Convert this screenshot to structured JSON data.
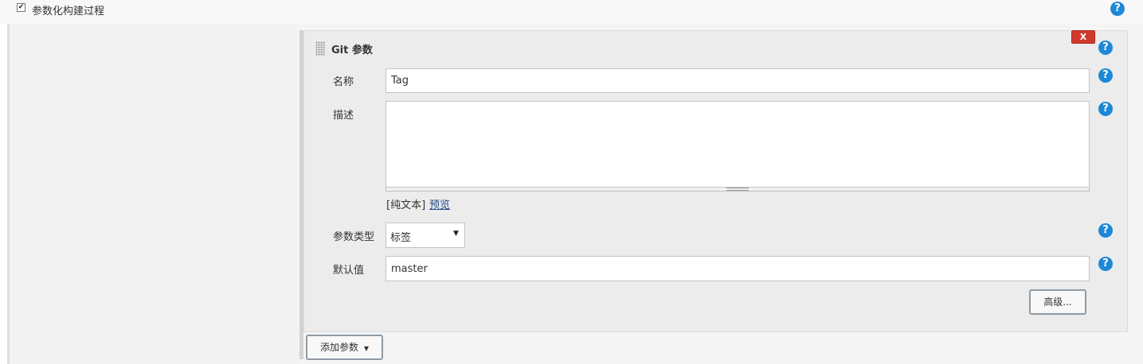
{
  "section": {
    "checked": true,
    "title": "参数化构建过程"
  },
  "parameter": {
    "header": "Git 参数",
    "delete_label": "X",
    "name_label": "名称",
    "name_value": "Tag",
    "description_label": "描述",
    "description_value": "",
    "format_text": "[纯文本]",
    "preview_link": "预览",
    "type_label": "参数类型",
    "type_value": "标签",
    "default_label": "默认值",
    "default_value": "master",
    "advanced_button": "高级..."
  },
  "add_parameter_button": "添加参数",
  "help_icon_glyph": "?",
  "colors": {
    "help_icon": "#1e88d6",
    "delete_button": "#cf3a2c",
    "link": "#204a87"
  }
}
